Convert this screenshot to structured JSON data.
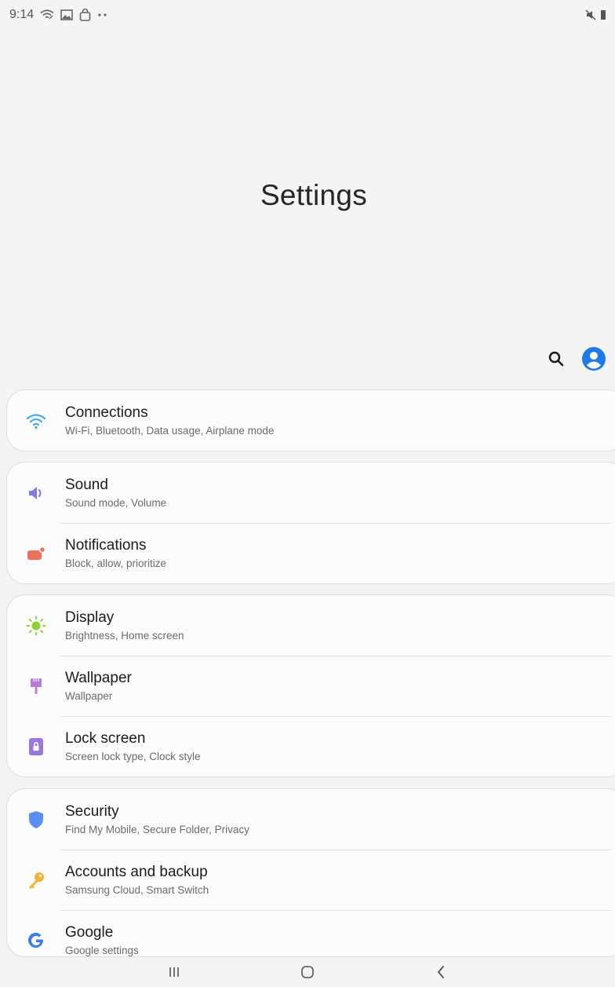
{
  "status_bar": {
    "time": "9:14",
    "icons": [
      "wifi-icon",
      "gallery-icon",
      "bag-icon",
      "more-dots-icon"
    ],
    "right_icons": [
      "mute-icon",
      "battery-icon"
    ]
  },
  "header": {
    "title": "Settings",
    "actions": [
      "search-icon",
      "account-icon"
    ]
  },
  "colors": {
    "background": "#f4f4f4",
    "card": "#fcfcfc",
    "account_blue": "#1f7ae8",
    "connections": "#4aa8e8",
    "sound": "#7e79e3",
    "notifications": "#ef6f5f",
    "display": "#8cd13a",
    "wallpaper": "#b77ad6",
    "lock_screen": "#9a78e0",
    "security": "#5b8ef0",
    "accounts": "#f2b233",
    "google": "#3b7de8"
  },
  "groups": [
    {
      "items": [
        {
          "title": "Connections",
          "subtitle": "Wi-Fi, Bluetooth, Data usage, Airplane mode",
          "icon": "wifi-icon"
        }
      ]
    },
    {
      "items": [
        {
          "title": "Sound",
          "subtitle": "Sound mode, Volume",
          "icon": "speaker-icon"
        },
        {
          "title": "Notifications",
          "subtitle": "Block, allow, prioritize",
          "icon": "notification-icon"
        }
      ]
    },
    {
      "items": [
        {
          "title": "Display",
          "subtitle": "Brightness, Home screen",
          "icon": "sun-icon"
        },
        {
          "title": "Wallpaper",
          "subtitle": "Wallpaper",
          "icon": "paintbrush-icon"
        },
        {
          "title": "Lock screen",
          "subtitle": "Screen lock type, Clock style",
          "icon": "lock-icon"
        }
      ]
    },
    {
      "items": [
        {
          "title": "Security",
          "subtitle": "Find My Mobile, Secure Folder, Privacy",
          "icon": "shield-icon"
        },
        {
          "title": "Accounts and backup",
          "subtitle": "Samsung Cloud, Smart Switch",
          "icon": "key-icon"
        },
        {
          "title": "Google",
          "subtitle": "Google settings",
          "icon": "google-icon"
        }
      ]
    }
  ],
  "nav_bar": {
    "buttons": [
      "recents-icon",
      "home-icon",
      "back-icon"
    ]
  }
}
